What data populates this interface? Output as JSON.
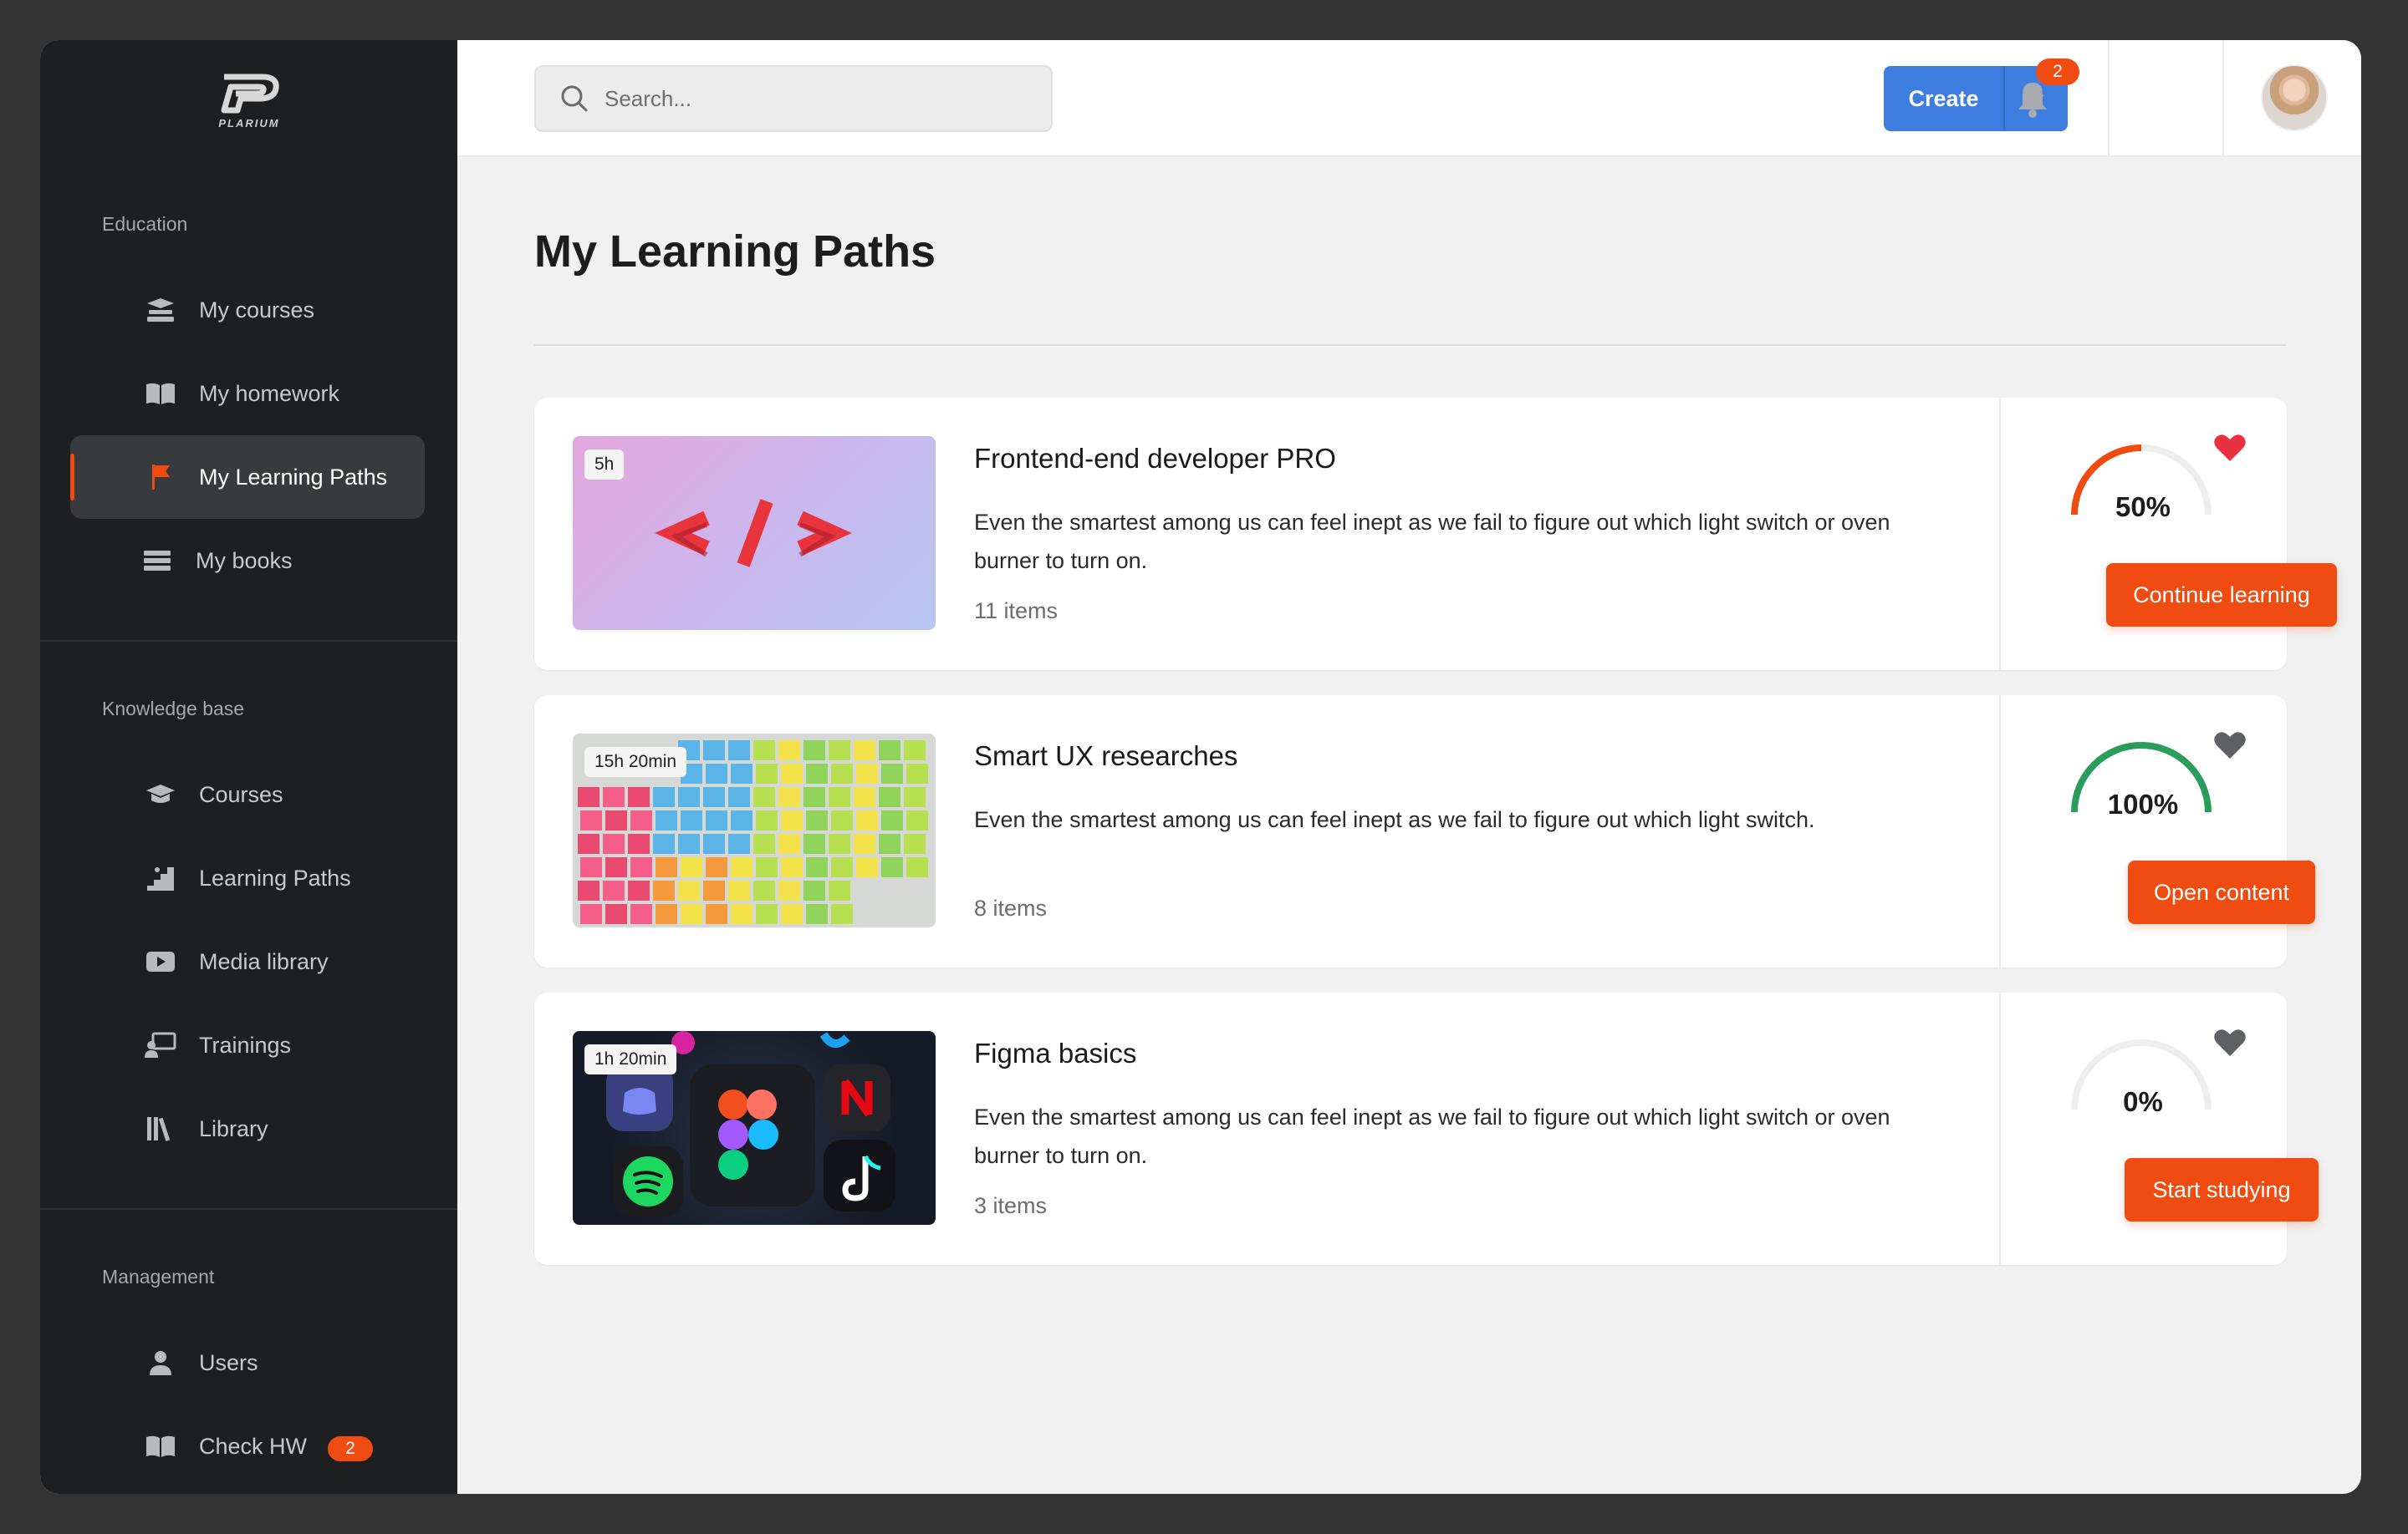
{
  "brand": {
    "name": "PLARIUM"
  },
  "sidebar": {
    "sections": [
      {
        "label": "Education"
      },
      {
        "label": "Knowledge base"
      },
      {
        "label": "Management"
      }
    ],
    "education": [
      {
        "label": "My courses",
        "icon": "stacked-books-icon"
      },
      {
        "label": "My homework",
        "icon": "open-book-icon"
      },
      {
        "label": "My Learning Paths",
        "icon": "flag-icon",
        "active": true
      },
      {
        "label": "My books",
        "icon": "list-lines-icon"
      }
    ],
    "knowledge": [
      {
        "label": "Courses",
        "icon": "graduation-cap-icon"
      },
      {
        "label": "Learning Paths",
        "icon": "stairs-icon"
      },
      {
        "label": "Media library",
        "icon": "play-video-icon"
      },
      {
        "label": "Trainings",
        "icon": "presentation-icon"
      },
      {
        "label": "Library",
        "icon": "library-books-icon"
      }
    ],
    "management": [
      {
        "label": "Users",
        "icon": "user-icon"
      },
      {
        "label": "Check HW",
        "icon": "open-book-icon",
        "badge": "2"
      }
    ]
  },
  "topbar": {
    "search_placeholder": "Search...",
    "create_label": "Create",
    "notifications_count": "2"
  },
  "page": {
    "title": "My Learning Paths"
  },
  "paths": [
    {
      "duration": "5h",
      "title": "Frontend-end developer PRO",
      "description": "Even the smartest among us can feel inept as we fail to figure out which light switch or oven burner to turn on.",
      "items": "11 items",
      "progress": 50,
      "progress_label": "50%",
      "favorite": true,
      "cta": "Continue learning",
      "thumb": "code-tag-thumbnail"
    },
    {
      "duration": "15h 20min",
      "title": "Smart UX researches",
      "description": "Even the smartest among us can feel inept as we fail to figure out which light switch.",
      "items": "8 items",
      "progress": 100,
      "progress_label": "100%",
      "favorite": false,
      "cta": "Open content",
      "thumb": "sticky-notes-thumbnail"
    },
    {
      "duration": "1h 20min",
      "title": "Figma basics",
      "description": "Even the smartest among us can feel inept as we fail to figure out which light switch or oven burner to turn on.",
      "items": "3 items",
      "progress": 0,
      "progress_label": "0%",
      "favorite": false,
      "cta": "Start studying",
      "thumb": "app-icons-thumbnail"
    }
  ],
  "colors": {
    "accent": "#f04c12",
    "primary": "#3d7de0",
    "success": "#2a9d5c",
    "sidebar_bg": "#1e1f21",
    "favorite": "#ea3142"
  }
}
